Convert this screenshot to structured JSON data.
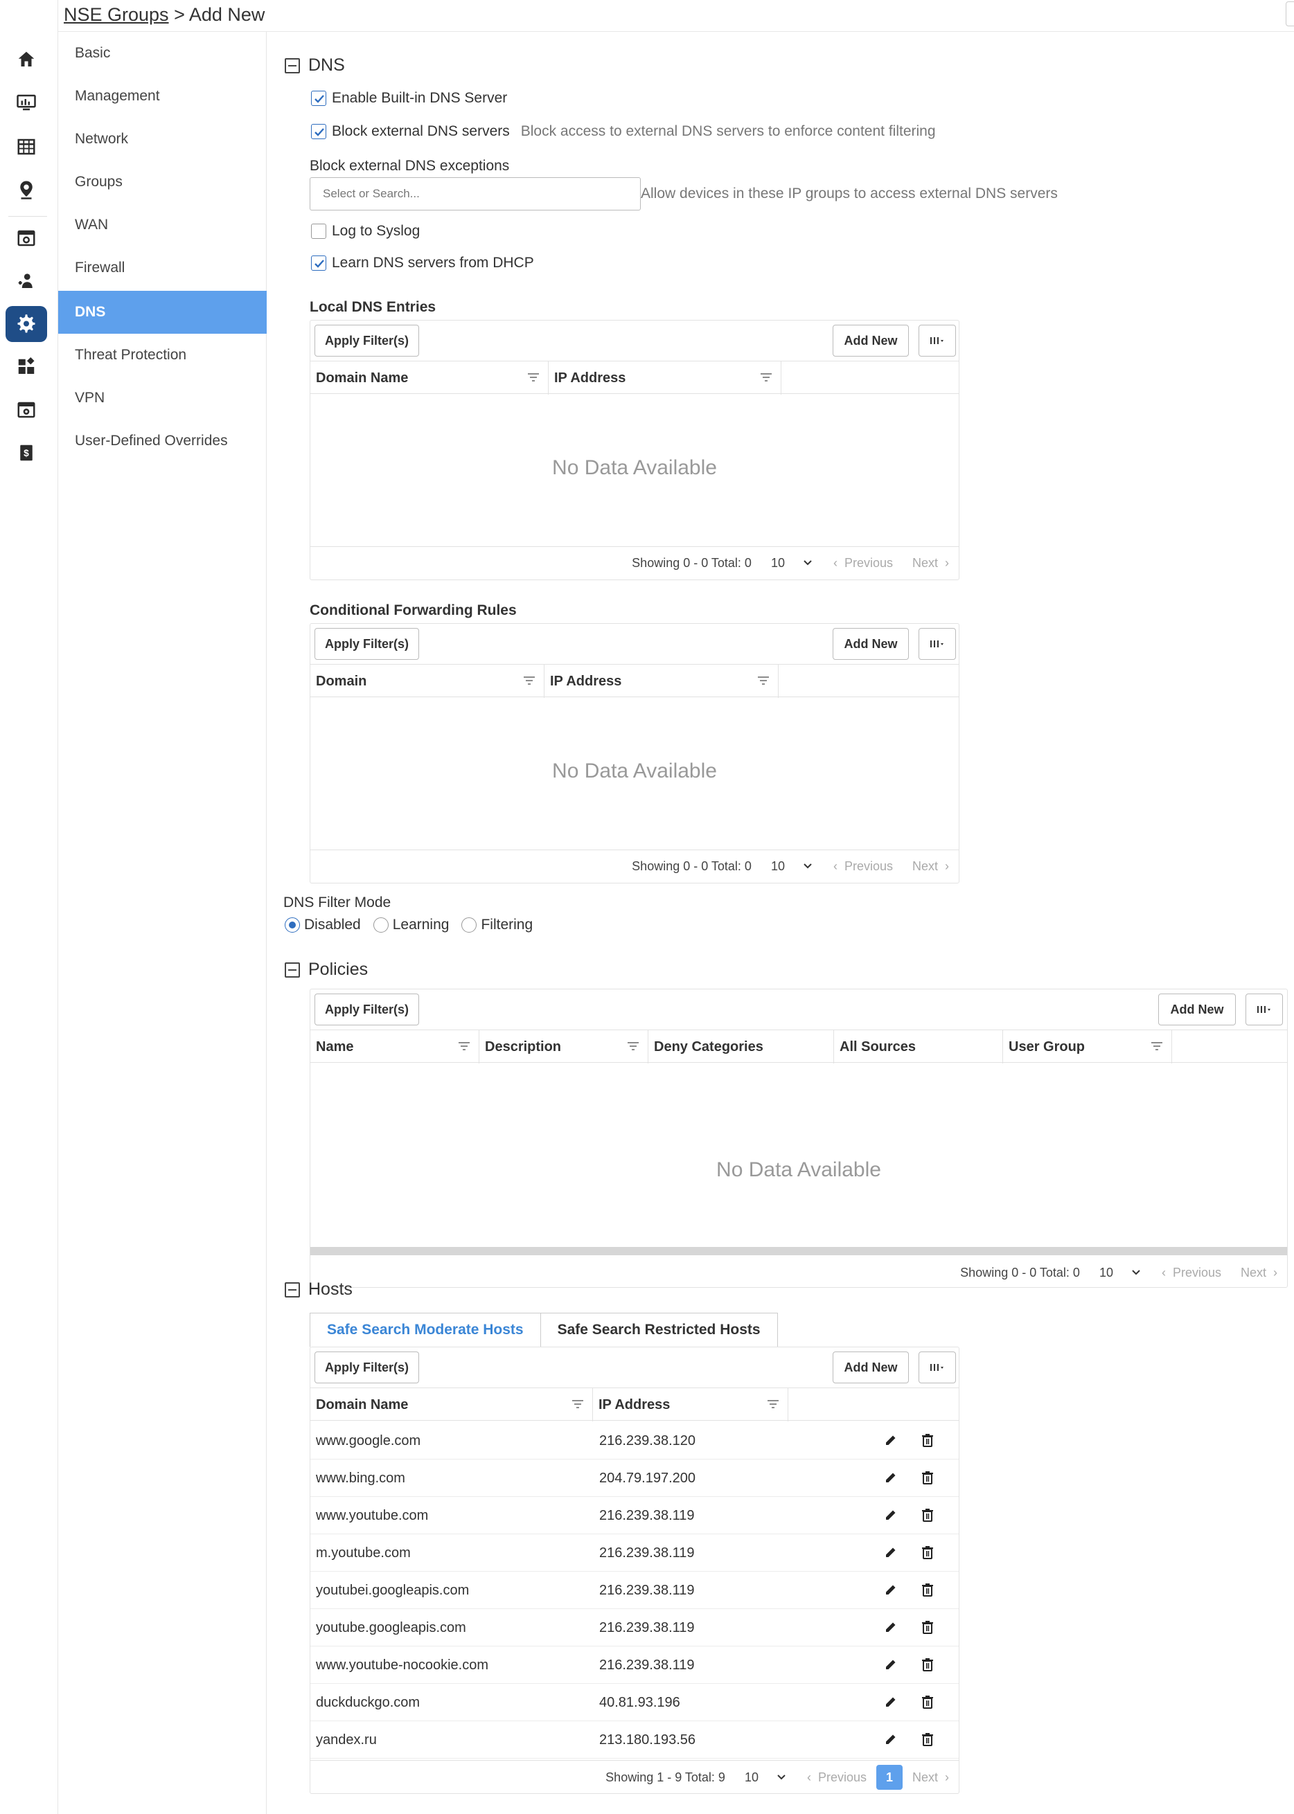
{
  "breadcrumb": {
    "parent": "NSE Groups",
    "separator": ">",
    "current": "Add New"
  },
  "rail": {
    "icons": [
      "home-icon",
      "monitor-chart-icon",
      "table-icon",
      "location-pin-icon",
      "browser-window-icon",
      "user-plus-icon",
      "gear-icon",
      "widgets-icon",
      "web-settings-icon",
      "billing-icon"
    ],
    "active_index": 6
  },
  "subnav": {
    "items": [
      {
        "label": "Basic"
      },
      {
        "label": "Management"
      },
      {
        "label": "Network"
      },
      {
        "label": "Groups"
      },
      {
        "label": "WAN"
      },
      {
        "label": "Firewall"
      },
      {
        "label": "DNS"
      },
      {
        "label": "Threat Protection"
      },
      {
        "label": "VPN"
      },
      {
        "label": "User-Defined Overrides"
      }
    ],
    "active_index": 6
  },
  "dns": {
    "title": "DNS",
    "enable_builtin": {
      "label": "Enable Built-in DNS Server",
      "checked": true
    },
    "block_external": {
      "label": "Block external DNS servers",
      "checked": true,
      "hint": "Block access to external DNS servers to enforce content filtering"
    },
    "exceptions": {
      "label": "Block external DNS exceptions",
      "placeholder": "Select or Search...",
      "hint": "Allow devices in these IP groups to access external DNS servers"
    },
    "log_syslog": {
      "label": "Log to Syslog",
      "checked": false
    },
    "learn_dhcp": {
      "label": "Learn DNS servers from DHCP",
      "checked": true
    }
  },
  "grid_common": {
    "apply_filters": "Apply Filter(s)",
    "add_new": "Add New",
    "no_data": "No Data Available",
    "previous": "Previous",
    "next": "Next",
    "page_size": "10"
  },
  "local_dns": {
    "title": "Local DNS Entries",
    "columns": [
      "Domain Name",
      "IP Address"
    ],
    "showing": "Showing 0 - 0 Total: 0"
  },
  "cond_fwd": {
    "title": "Conditional Forwarding Rules",
    "columns": [
      "Domain",
      "IP Address"
    ],
    "showing": "Showing 0 - 0 Total: 0"
  },
  "filter_mode": {
    "label": "DNS Filter Mode",
    "options": [
      "Disabled",
      "Learning",
      "Filtering"
    ],
    "selected": "Disabled"
  },
  "policies": {
    "title": "Policies",
    "columns": [
      "Name",
      "Description",
      "Deny Categories",
      "All Sources",
      "User Group"
    ],
    "showing": "Showing 0 - 0 Total: 0"
  },
  "hosts": {
    "title": "Hosts",
    "tabs": [
      "Safe Search Moderate Hosts",
      "Safe Search Restricted Hosts"
    ],
    "active_tab": 0,
    "columns": [
      "Domain Name",
      "IP Address"
    ],
    "rows": [
      {
        "domain": "www.google.com",
        "ip": "216.239.38.120"
      },
      {
        "domain": "www.bing.com",
        "ip": "204.79.197.200"
      },
      {
        "domain": "www.youtube.com",
        "ip": "216.239.38.119"
      },
      {
        "domain": "m.youtube.com",
        "ip": "216.239.38.119"
      },
      {
        "domain": "youtubei.googleapis.com",
        "ip": "216.239.38.119"
      },
      {
        "domain": "youtube.googleapis.com",
        "ip": "216.239.38.119"
      },
      {
        "domain": "www.youtube-nocookie.com",
        "ip": "216.239.38.119"
      },
      {
        "domain": "duckduckgo.com",
        "ip": "40.81.93.196"
      },
      {
        "domain": "yandex.ru",
        "ip": "213.180.193.56"
      }
    ],
    "showing": "Showing 1 - 9 Total: 9",
    "current_page": "1"
  },
  "colors": {
    "accent": "#5ea0ec",
    "rail_active": "#1f4d87",
    "tab_active_text": "#3b86d6",
    "check": "#2e6dbf"
  }
}
